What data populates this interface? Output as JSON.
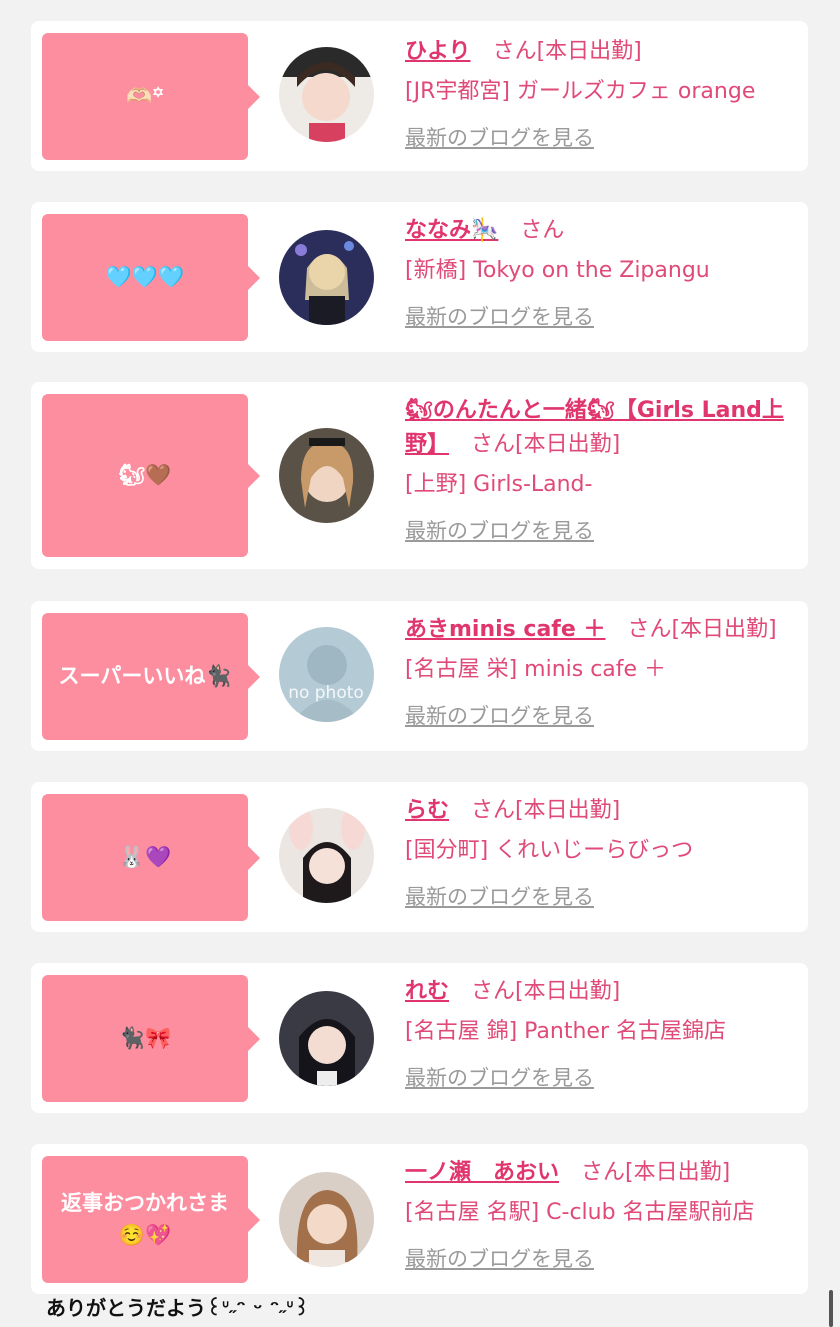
{
  "cards": [
    {
      "bubble": "🫶🏻꙳",
      "name": "ひより",
      "san": "さん[本日出勤]",
      "shop": "[JR宇都宮] ガールズカフェ orange",
      "blog": "最新のブログを見る",
      "avatar": "photo"
    },
    {
      "bubble": "🩵🩵🩵",
      "name": "ななみ🎠",
      "san": "さん",
      "shop": "[新橋] Tokyo on the Zipangu",
      "blog": "最新のブログを見る",
      "avatar": "photo"
    },
    {
      "bubble": "🐿🤎",
      "name": "🐿のんたんと一緒🐿【Girls Land上野】",
      "san": "さん[本日出勤]",
      "shop": "[上野] Girls-Land-",
      "blog": "最新のブログを見る",
      "avatar": "photo"
    },
    {
      "bubble": "スーパーいいね🐈‍⬛",
      "name": "あきminis cafe ＋",
      "san": "さん[本日出勤]",
      "shop": "[名古屋 栄] minis cafe ＋",
      "blog": "最新のブログを見る",
      "avatar": "no photo"
    },
    {
      "bubble": "🐰💜",
      "name": "らむ",
      "san": "さん[本日出勤]",
      "shop": "[国分町] くれいじーらびっつ",
      "blog": "最新のブログを見る",
      "avatar": "photo"
    },
    {
      "bubble": "🐈‍⬛🎀",
      "name": "れむ",
      "san": "さん[本日出勤]",
      "shop": "[名古屋 錦] Panther 名古屋錦店",
      "blog": "最新のブログを見る",
      "avatar": "photo"
    },
    {
      "bubble": "返事おつかれさま\n☺️💖",
      "name": "一ノ瀬　あおい",
      "san": "さん[本日出勤]",
      "shop": "[名古屋 名駅] C-club 名古屋駅前店",
      "blog": "最新のブログを見る",
      "avatar": "photo"
    }
  ],
  "footer": {
    "text": "ありがとうだよう꒰ᐡ˶ᵔ ᵕ ᵔ˶ᐡ꒱"
  },
  "colors": {
    "accent": "#e0356d",
    "bubble": "#fc8ea0",
    "background": "#f2f2f2"
  }
}
